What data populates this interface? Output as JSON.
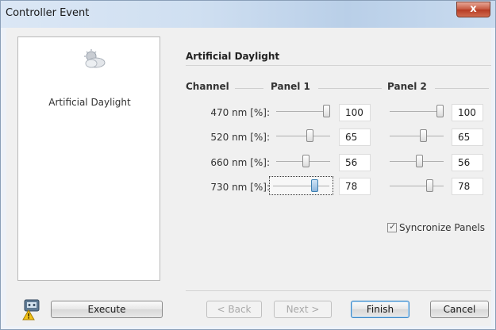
{
  "window": {
    "title": "Controller Event",
    "close_label": "x"
  },
  "left_panel": {
    "label": "Artificial Daylight",
    "icon": "daylight-icon"
  },
  "section": {
    "title": "Artificial Daylight"
  },
  "columns": {
    "channel": "Channel",
    "panel1": "Panel 1",
    "panel2": "Panel 2"
  },
  "rows": [
    {
      "label": "470 nm [%]:",
      "panel1": "100",
      "panel2": "100",
      "panel1_level": 1.0,
      "panel2_level": 1.0
    },
    {
      "label": "520 nm [%]:",
      "panel1": "65",
      "panel2": "65",
      "panel1_level": 0.65,
      "panel2_level": 0.65
    },
    {
      "label": "660 nm [%]:",
      "panel1": "56",
      "panel2": "56",
      "panel1_level": 0.56,
      "panel2_level": 0.56
    },
    {
      "label": "730 nm [%]:",
      "panel1": "78",
      "panel2": "78",
      "panel1_level": 0.78,
      "panel2_level": 0.78
    }
  ],
  "sync": {
    "label": "Syncronize Panels",
    "checked": true,
    "check_glyph": "✓"
  },
  "buttons": {
    "execute": "Execute",
    "back": "< Back",
    "next": "Next >",
    "finish": "Finish",
    "cancel": "Cancel"
  },
  "icons": {
    "alert": "warning-robot-icon"
  },
  "colors": {
    "accent": "#3b86c4",
    "title_bar": "#cfdff1",
    "close": "#c5573e"
  }
}
